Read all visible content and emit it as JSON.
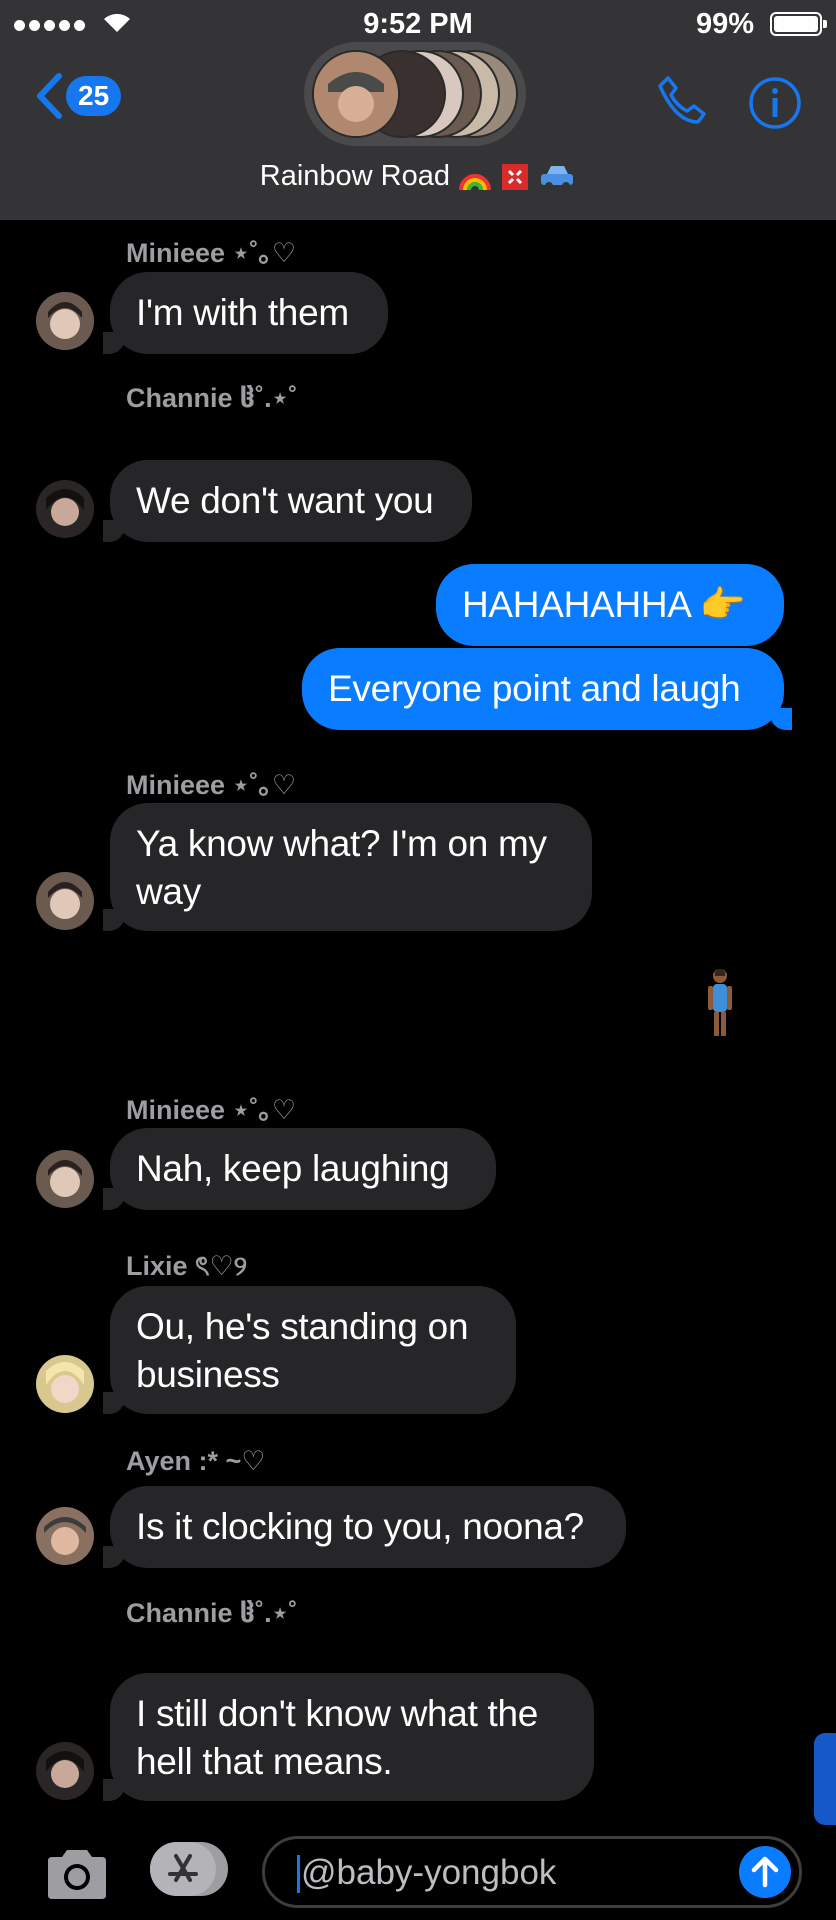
{
  "status_bar": {
    "time": "9:52 PM",
    "battery": "99%"
  },
  "header": {
    "back_count": "25",
    "group_name": "Rainbow Road",
    "group_emojis": [
      "rainbow-emoji",
      "anger-emoji",
      "car-emoji"
    ]
  },
  "messages": [
    {
      "sender": "Minieee ⋆˚｡♡",
      "text": "I'm with them",
      "dir": "in"
    },
    {
      "sender": "Channie ჱ˚.⋆˚",
      "text": "We don't want you",
      "dir": "in"
    },
    {
      "text": "HAHAHAHHA 👉",
      "dir": "out"
    },
    {
      "text": "Everyone point and laugh",
      "dir": "out"
    },
    {
      "sender": "Minieee ⋆˚｡♡",
      "text_lines": [
        "Ya know what? I'm on my",
        "way"
      ],
      "dir": "in"
    },
    {
      "reaction_icon": "standing-person-emoji",
      "dir": "out"
    },
    {
      "sender": "Minieee ⋆˚｡♡",
      "text": "Nah, keep laughing",
      "dir": "in"
    },
    {
      "sender": "Lixie ৎ♡୨",
      "text_lines": [
        "Ou, he's standing on",
        "business"
      ],
      "dir": "in"
    },
    {
      "sender": "Ayen :* ~♡",
      "text": "Is it clocking to you, noona?",
      "dir": "in"
    },
    {
      "sender": "Channie ჱ˚.⋆˚",
      "text_lines": [
        "I still don't know what the",
        "hell that means."
      ],
      "dir": "in"
    }
  ],
  "composer": {
    "value": "@baby-yongbok"
  },
  "colors": {
    "header_bg": "#343436",
    "incoming_bubble": "#262628",
    "outgoing_bubble": "#0a7cff",
    "accent": "#1677ee"
  }
}
